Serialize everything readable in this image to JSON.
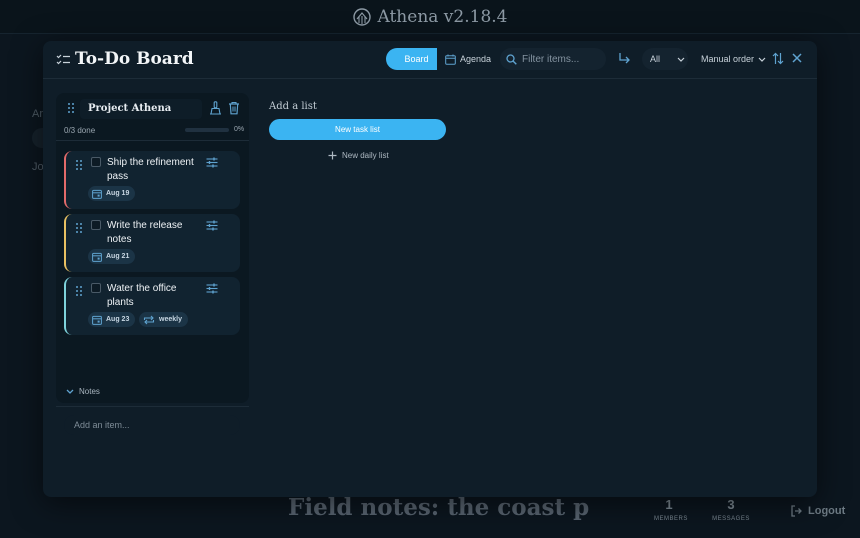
{
  "app": {
    "title": "Athena v2.18.4"
  },
  "background": {
    "side_a": "Ar",
    "side_j": "Jo",
    "headline": "Field notes: the coast p",
    "stats": [
      {
        "num": "1",
        "label": "MEMBERS"
      },
      {
        "num": "3",
        "label": "MESSAGES"
      }
    ],
    "logout": "Logout"
  },
  "modal": {
    "title": "To-Do Board",
    "views": {
      "board": "Board",
      "agenda": "Agenda"
    },
    "filter_placeholder": "Filter items...",
    "scope_select": "All",
    "order_select": "Manual order"
  },
  "list": {
    "name": "Project Athena",
    "done_text": "0/3 done",
    "progress": 0,
    "progress_label": "0%",
    "tasks": [
      {
        "title": "Ship the refinement pass",
        "date": "Aug 19",
        "accent": "#e26a6a"
      },
      {
        "title": "Write the release notes",
        "date": "Aug 21",
        "accent": "#e8c062"
      },
      {
        "title": "Water the office plants",
        "date": "Aug 23",
        "accent": "#7fd3dc",
        "repeat": "weekly"
      }
    ],
    "notes_label": "Notes",
    "add_item_placeholder": "Add an item..."
  },
  "add_list": {
    "heading": "Add a list",
    "new_task_list": "New task list",
    "new_daily_list": "New daily list"
  },
  "colors": {
    "accent": "#3bb4f2",
    "modal_bg": "#0f1d28",
    "page_bg": "#0c161f"
  }
}
